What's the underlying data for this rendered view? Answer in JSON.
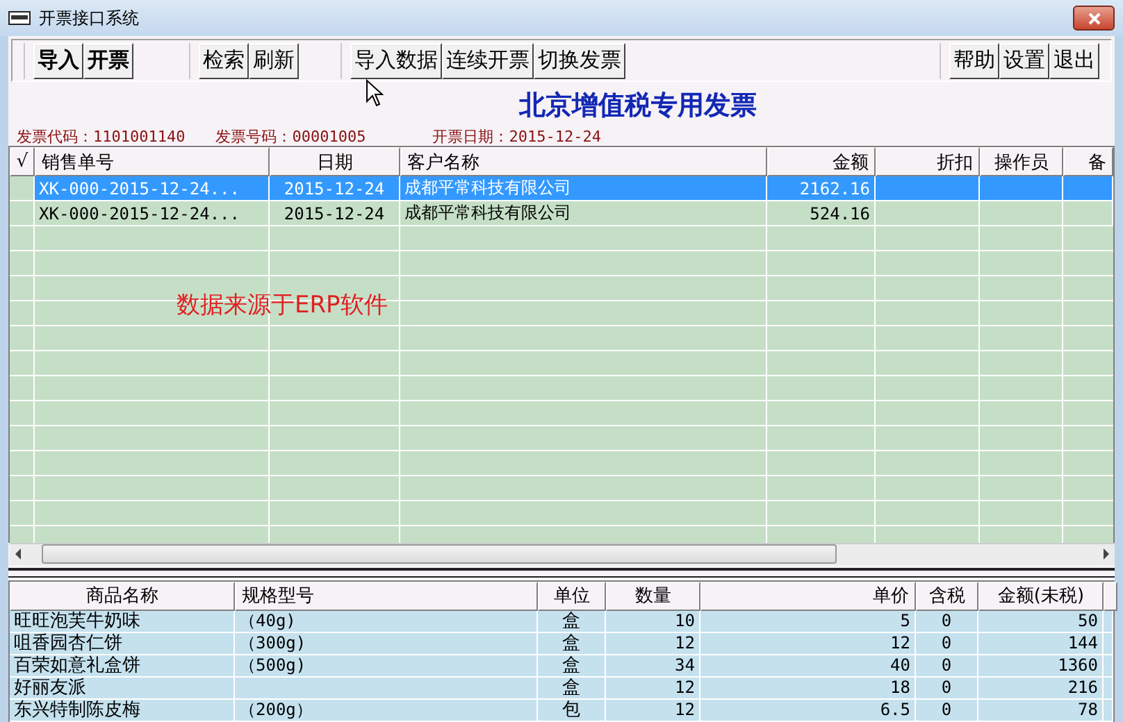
{
  "window": {
    "title": "开票接口系统"
  },
  "toolbar": [
    [
      "导入",
      "开票"
    ],
    [
      "检索",
      "刷新"
    ],
    [
      "导入数据",
      "连续开票",
      "切换发票"
    ],
    [
      "帮助",
      "设置",
      "退出"
    ]
  ],
  "invoice": {
    "title": "北京增值税专用发票",
    "fields": [
      {
        "label": "发票代码：",
        "value": "1101001140"
      },
      {
        "label": "发票号码：",
        "value": "00001005"
      },
      {
        "label": "开票日期：",
        "value": "2015-12-24"
      }
    ]
  },
  "orders": {
    "columns": [
      "√",
      "销售单号",
      "日期",
      "客户名称",
      "金额",
      "折扣",
      "操作员",
      "备"
    ],
    "rows": [
      {
        "selected": true,
        "cells": [
          "",
          "XK-000-2015-12-24...",
          "2015-12-24",
          "成都平常科技有限公司",
          "2162.16"
        ]
      },
      {
        "selected": false,
        "cells": [
          "",
          "XK-000-2015-12-24...",
          "2015-12-24",
          "成都平常科技有限公司",
          "524.16"
        ]
      }
    ],
    "note": "数据来源于ERP软件"
  },
  "items": {
    "columns": [
      "商品名称",
      "规格型号",
      "单位",
      "数量",
      "单价",
      "含税",
      "金额(未税)"
    ],
    "rows": [
      [
        "旺旺泡芙牛奶味",
        "（40g)",
        "盒",
        "10",
        "5",
        "0",
        "50"
      ],
      [
        "咀香园杏仁饼",
        "（300g)",
        "盒",
        "12",
        "12",
        "0",
        "144"
      ],
      [
        "百荣如意礼盒饼",
        "（500g)",
        "盒",
        "34",
        "40",
        "0",
        "1360"
      ],
      [
        "好丽友派",
        "",
        "盒",
        "12",
        "18",
        "0",
        "216"
      ],
      [
        "东兴特制陈皮梅",
        "（200g）",
        "包",
        "12",
        "6.5",
        "0",
        "78"
      ]
    ]
  }
}
